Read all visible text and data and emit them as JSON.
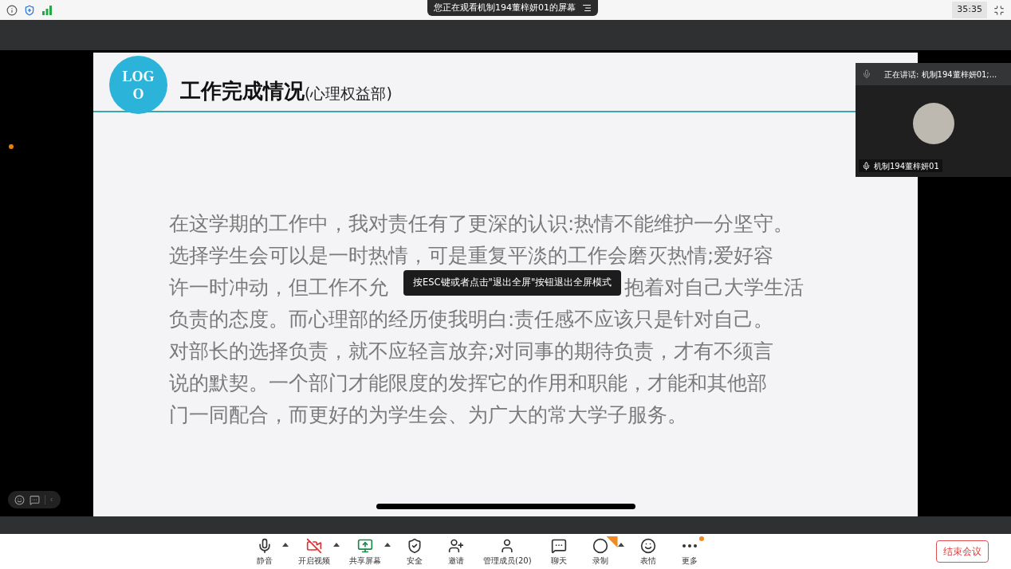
{
  "top_bar": {
    "sharing_notice": "您正在观看机制194董梓妍01的屏幕",
    "timer": "35:35"
  },
  "slide": {
    "logo": "LOG O",
    "title": "工作完成情况",
    "subtitle": "(心理权益部)",
    "lines": [
      {
        "segments": [
          "在这学期的工作中，我对责任有了更深的认识:热情不能维护一分坚守。"
        ]
      },
      {
        "segments": [
          "选择学生会可以是一时热情，可是重复平淡的工作会磨灭热情;爱好容"
        ]
      },
      {
        "segments": [
          "许一时冲动，但工作不允",
          "抱着对自己大学生活"
        ]
      },
      {
        "segments": [
          "负责的态度。而心理部的经历使我明白:责任感不应该只是针对自己。"
        ]
      },
      {
        "segments": [
          "对部长的选择负责，就不应轻言放弃;对同事的期待负责，才有不须言"
        ]
      },
      {
        "segments": [
          "说的默契。一个部门才能限度的发挥它的作用和职能，才能和其他部"
        ]
      },
      {
        "segments": [
          "门一同配合，而更好的为学生会、为广大的常大学子服务。"
        ]
      }
    ]
  },
  "tooltip": "按ESC键或者点击\"退出全屏\"按钮退出全屏模式",
  "speaker_panel": {
    "speaking": "正在讲话: 机制194董梓妍01;...",
    "name": "机制194董梓妍01"
  },
  "toolbar": [
    {
      "kind": "mic",
      "label": "静音",
      "caret": true,
      "dot": false,
      "ribbon": false
    },
    {
      "kind": "video",
      "label": "开启视频",
      "caret": true,
      "dot": false,
      "ribbon": false
    },
    {
      "kind": "share",
      "label": "共享屏幕",
      "caret": true,
      "dot": false,
      "ribbon": false
    },
    {
      "kind": "security",
      "label": "安全",
      "caret": false,
      "dot": false,
      "ribbon": false
    },
    {
      "kind": "invite",
      "label": "邀请",
      "caret": false,
      "dot": false,
      "ribbon": false
    },
    {
      "kind": "members",
      "label": "管理成员(20)",
      "caret": false,
      "dot": false,
      "ribbon": false
    },
    {
      "kind": "chat",
      "label": "聊天",
      "caret": false,
      "dot": false,
      "ribbon": false
    },
    {
      "kind": "record",
      "label": "录制",
      "caret": true,
      "dot": false,
      "ribbon": true
    },
    {
      "kind": "emoji",
      "label": "表情",
      "caret": false,
      "dot": false,
      "ribbon": false
    },
    {
      "kind": "more",
      "label": "更多",
      "caret": false,
      "dot": true,
      "ribbon": false
    }
  ],
  "end_button": "结束会议"
}
